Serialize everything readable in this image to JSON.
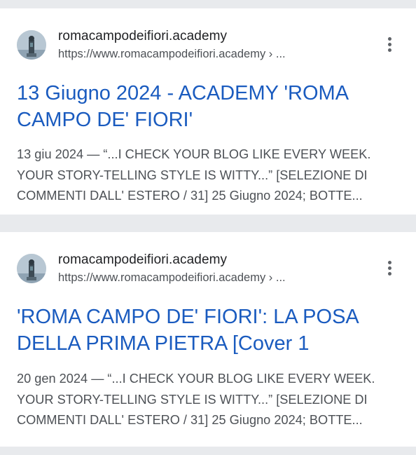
{
  "results": [
    {
      "site_name": "romacampodeifiori.academy",
      "url": "https://www.romacampodeifiori.academy",
      "url_suffix": " › ...",
      "title_line1": "13 Giugno 2024 - ACADEMY 'ROMA",
      "title_line2": "CAMPO DE' FIORI'",
      "snippet_line1": "13 giu 2024 — “...I CHECK YOUR BLOG LIKE EVERY WEEK.",
      "snippet_line2": "YOUR STORY-TELLING STYLE IS WITTY...” [SELEZIONE DI",
      "snippet_line3": "COMMENTI DALL' ESTERO / 31] 25 Giugno 2024; BOTTE..."
    },
    {
      "site_name": "romacampodeifiori.academy",
      "url": "https://www.romacampodeifiori.academy",
      "url_suffix": " › ...",
      "title_line1": "'ROMA CAMPO DE' FIORI': LA POSA",
      "title_line2": "DELLA PRIMA PIETRA [Cover 1",
      "snippet_line1": "20 gen 2024 — “...I CHECK YOUR BLOG LIKE EVERY WEEK.",
      "snippet_line2": "YOUR STORY-TELLING STYLE IS WITTY...” [SELEZIONE DI",
      "snippet_line3": "COMMENTI DALL' ESTERO / 31] 25 Giugno 2024; BOTTE..."
    }
  ],
  "icons": {
    "favicon": "statue-favicon-icon",
    "more": "more-vert-icon"
  },
  "colors": {
    "title_link": "#1a5bbf",
    "snippet_text": "#4d5156",
    "background": "#e8eaed"
  }
}
